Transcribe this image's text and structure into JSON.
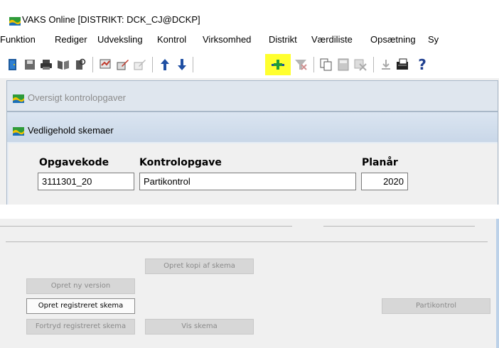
{
  "window": {
    "title": "VAKS Online [DISTRIKT: DCK_CJ@DCKP]"
  },
  "menu": [
    "Funktion",
    "Rediger",
    "Udveksling",
    "Kontrol",
    "Virksomhed",
    "Distrikt",
    "Værdiliste",
    "Opsætning",
    "Sy"
  ],
  "toolbar": {
    "icons": [
      "exit-door-icon",
      "save-icon",
      "print-icon",
      "book-open-icon",
      "book-search-icon",
      "report-icon",
      "edit-pen-icon",
      "edit-pen-disabled-icon",
      "arrow-up-icon",
      "arrow-down-icon",
      "add-row-icon",
      "delete-filter-icon",
      "copy-icon",
      "calculator-icon",
      "clear-icon",
      "download-icon",
      "register-icon",
      "help-icon"
    ],
    "help_label": "?"
  },
  "overview_window": {
    "title": "Oversigt kontrolopgaver"
  },
  "maintain_window": {
    "title": "Vedligehold skemaer",
    "fields": {
      "opgavekode_label": "Opgavekode",
      "opgavekode_value": "3111301_20",
      "kontrolopgave_label": "Kontrolopgave",
      "kontrolopgave_value": "Partikontrol",
      "planaar_label": "Planår",
      "planaar_value": "2020"
    }
  },
  "buttons": {
    "copy_schema": "Opret kopi af skema",
    "new_version": "Opret ny version",
    "create_registered": "Opret registreret skema",
    "undo_registered": "Fortryd registreret skema",
    "view_schema": "Vis skema",
    "partikontrol": "Partikontrol"
  },
  "colors": {
    "highlight": "#ffff2e",
    "titlebar_gradient_top": "#dbe5f1",
    "window_border": "#a9b8c8"
  }
}
